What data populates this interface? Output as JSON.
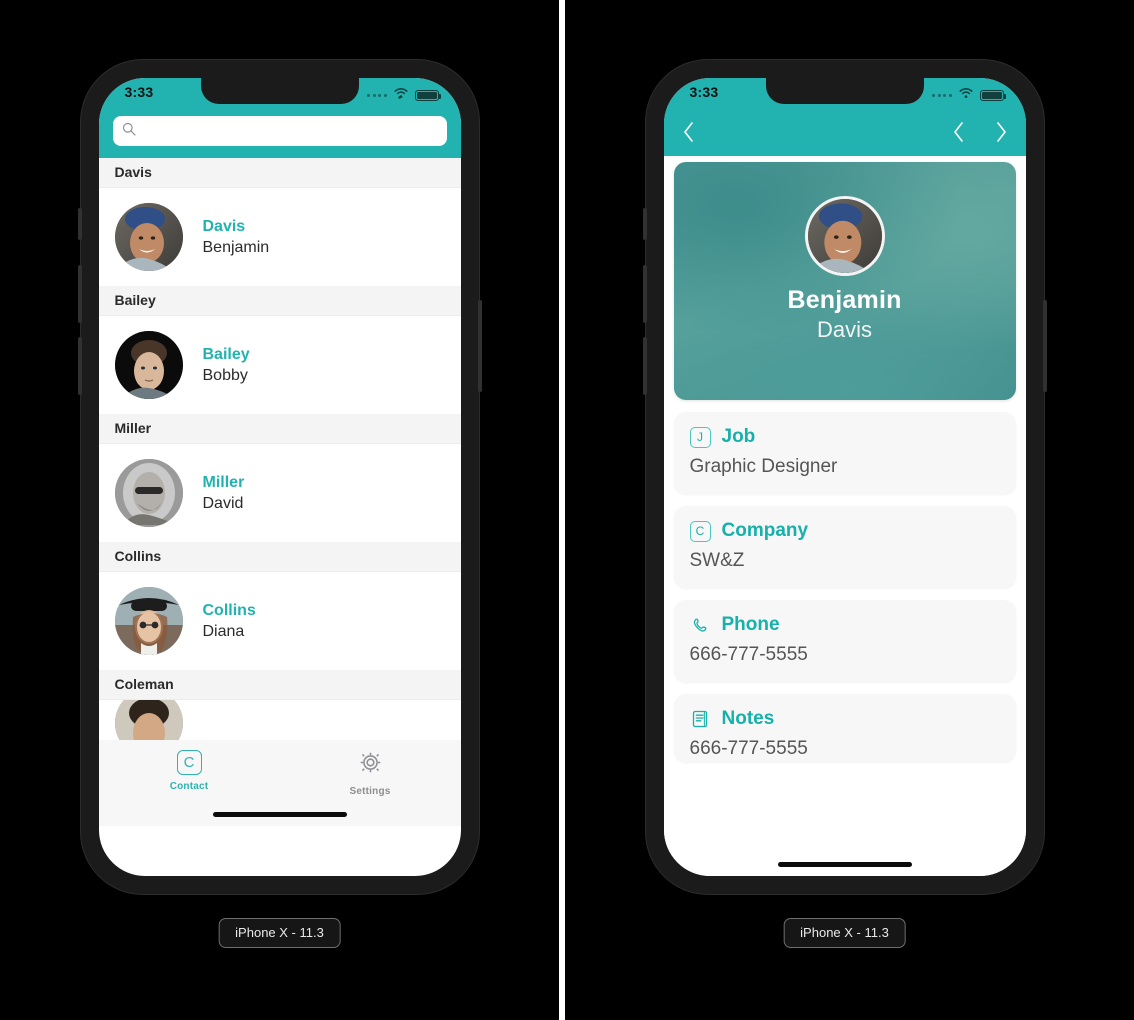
{
  "background_color": "#000000",
  "accent_color": "#22b2b0",
  "simulators": [
    {
      "device_caption": "iPhone X - 11.3",
      "status_bar": {
        "time": "3:33",
        "signal_icon": "signal-dots-icon",
        "wifi_icon": "wifi-icon",
        "battery_icon": "battery-icon"
      },
      "screen": "contacts-list",
      "search": {
        "value": "",
        "placeholder": "",
        "icon": "search-icon"
      },
      "sections": [
        {
          "header": "Davis",
          "contacts": [
            {
              "last_name": "Davis",
              "first_name": "Benjamin",
              "avatar": "avatar-benjamin-davis"
            }
          ]
        },
        {
          "header": "Bailey",
          "contacts": [
            {
              "last_name": "Bailey",
              "first_name": "Bobby",
              "avatar": "avatar-bobby-bailey"
            }
          ]
        },
        {
          "header": "Miller",
          "contacts": [
            {
              "last_name": "Miller",
              "first_name": "David",
              "avatar": "avatar-david-miller"
            }
          ]
        },
        {
          "header": "Collins",
          "contacts": [
            {
              "last_name": "Collins",
              "first_name": "Diana",
              "avatar": "avatar-diana-collins"
            }
          ]
        },
        {
          "header": "Coleman",
          "contacts": [
            {
              "last_name": "",
              "first_name": "",
              "avatar": "avatar-coleman"
            }
          ]
        }
      ],
      "tab_bar": [
        {
          "label": "Contact",
          "icon": "contact-c-icon",
          "active": true
        },
        {
          "label": "Settings",
          "icon": "gear-icon",
          "active": false
        }
      ]
    },
    {
      "device_caption": "iPhone X - 11.3",
      "status_bar": {
        "time": "3:33",
        "signal_icon": "signal-dots-icon",
        "wifi_icon": "wifi-icon",
        "battery_icon": "battery-icon"
      },
      "screen": "contact-detail",
      "nav_bar": {
        "back_icon": "chevron-left-icon",
        "prev_icon": "chevron-left-icon",
        "next_icon": "chevron-right-icon"
      },
      "hero": {
        "first_name": "Benjamin",
        "last_name": "Davis",
        "avatar": "avatar-benjamin-davis"
      },
      "info_cards": [
        {
          "icon": "letter-j-icon",
          "title": "Job",
          "value": "Graphic Designer",
          "clipped": false
        },
        {
          "icon": "letter-c-icon",
          "title": "Company",
          "value": "SW&Z",
          "clipped": false
        },
        {
          "icon": "phone-icon",
          "title": "Phone",
          "value": "666-777-5555",
          "clipped": false
        },
        {
          "icon": "notes-icon",
          "title": "Notes",
          "value": "666-777-5555",
          "clipped": true
        }
      ]
    }
  ]
}
